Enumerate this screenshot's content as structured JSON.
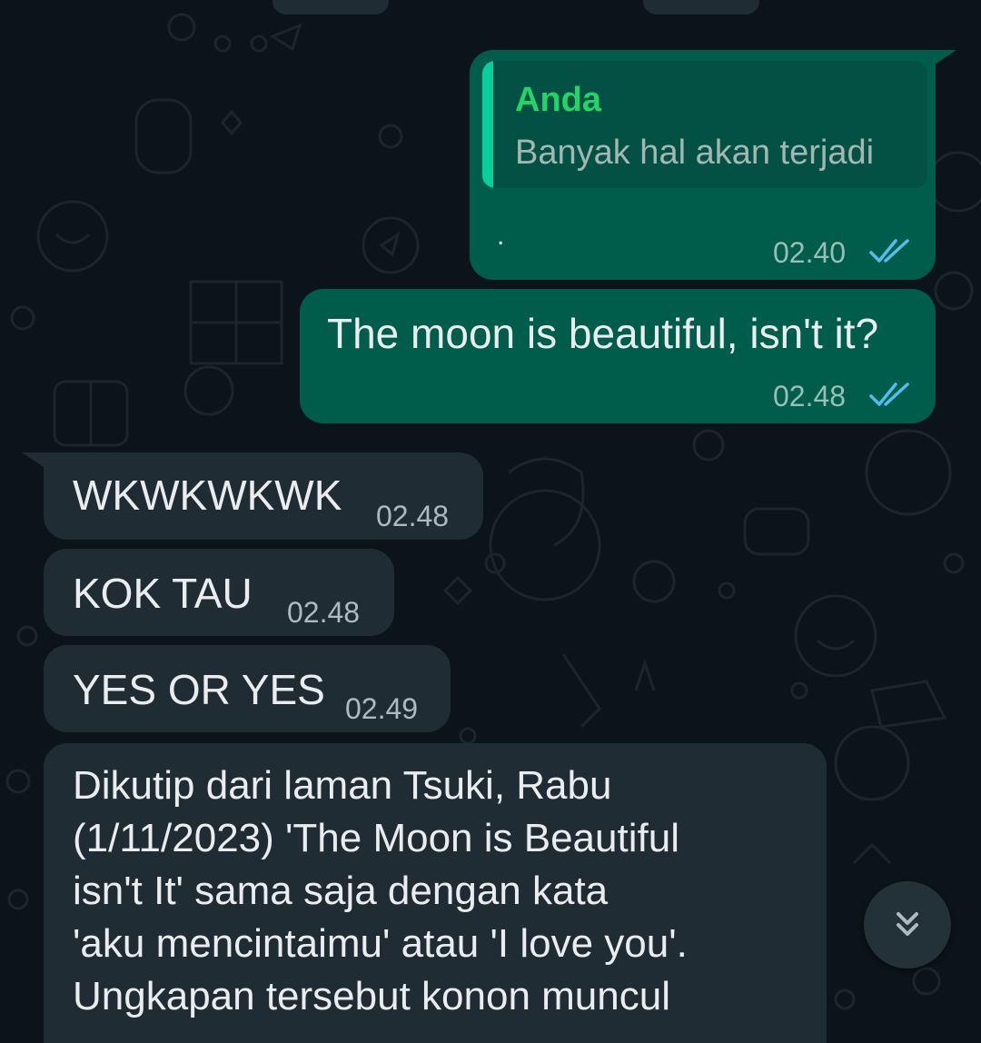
{
  "colors": {
    "background": "#0b141a",
    "outgoing_bubble": "#005c4b",
    "incoming_bubble": "#202c33",
    "quote_bar": "#06cf9c",
    "quote_author": "#25d366",
    "read_ticks": "#53bdeb"
  },
  "messages": [
    {
      "direction": "outgoing",
      "quote": {
        "author": "Anda",
        "text": "Banyak hal akan terjadi"
      },
      "text": ".",
      "time": "02.40",
      "status_icon": "double-check-read-icon"
    },
    {
      "direction": "outgoing",
      "text": "The moon is beautiful, isn't it?",
      "time": "02.48",
      "status_icon": "double-check-read-icon"
    },
    {
      "direction": "incoming",
      "text": "WKWKWKWK",
      "time": "02.48"
    },
    {
      "direction": "incoming",
      "text": "KOK TAU",
      "time": "02.48"
    },
    {
      "direction": "incoming",
      "text": "YES OR YES",
      "time": "02.49"
    },
    {
      "direction": "incoming",
      "text": "Dikutip dari laman Tsuki, Rabu\n(1/11/2023) 'The Moon is Beautiful\nisn't It' sama saja dengan kata\n'aku mencintaimu' atau 'I love you'.\nUngkapan tersebut konon muncul"
    }
  ],
  "scroll_button": {
    "icon": "double-chevron-down-icon"
  }
}
